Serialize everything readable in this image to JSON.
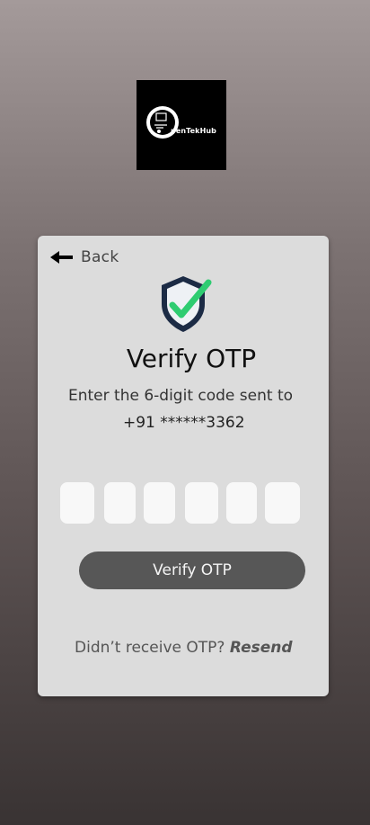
{
  "logo": {
    "text": "penTekHub"
  },
  "card": {
    "back_label": "Back",
    "title": "Verify OTP",
    "subtitle": "Enter the 6-digit code sent to",
    "phone": "+91 ******3362",
    "otp_digits": [
      "",
      "",
      "",
      "",
      "",
      ""
    ],
    "verify_button": "Verify OTP",
    "resend_prompt": "Didn’t receive OTP?",
    "resend_link": "Resend"
  },
  "colors": {
    "card_bg": "#dcdcdc",
    "button_bg": "#575757",
    "check_green": "#2ecc71",
    "shield_navy": "#1c2b45"
  }
}
